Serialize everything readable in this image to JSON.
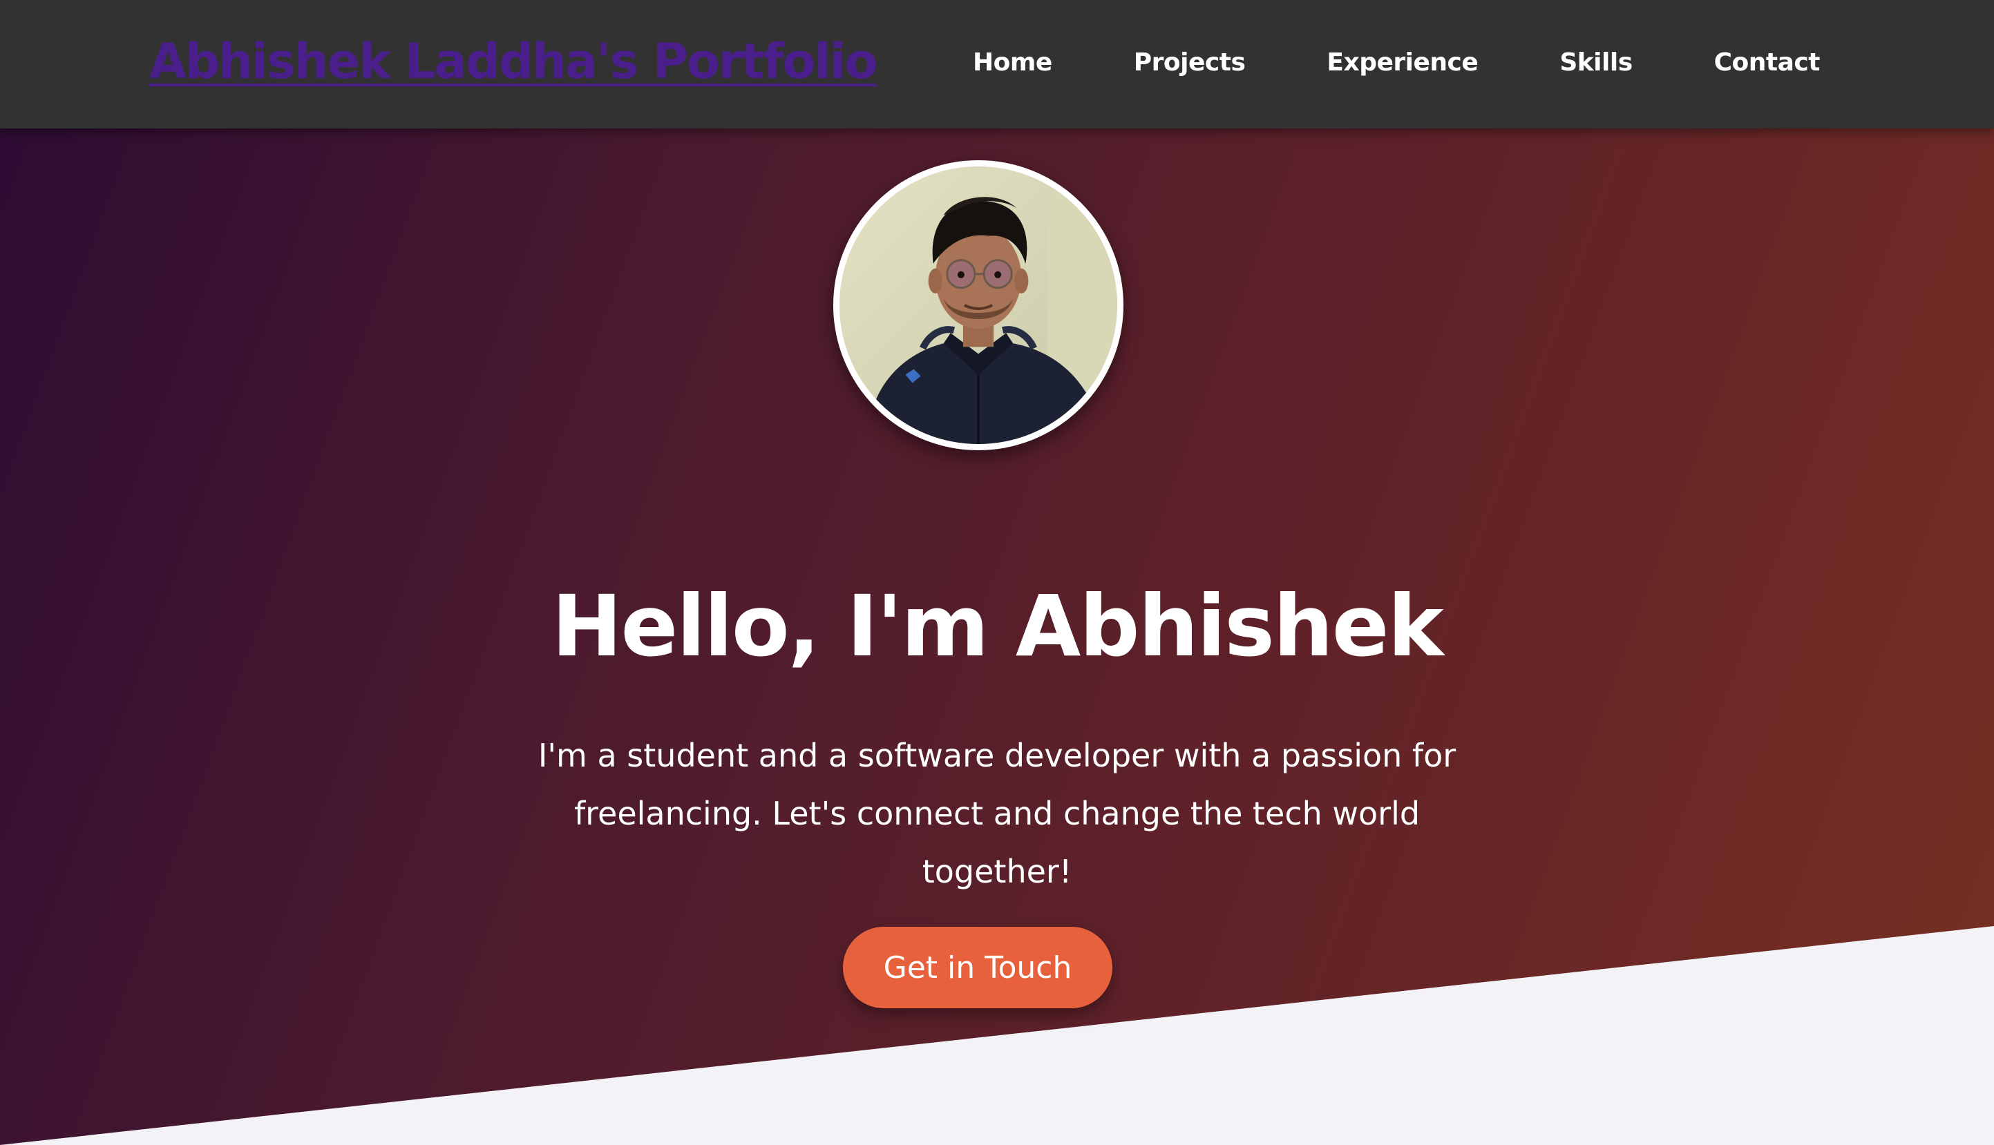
{
  "navbar": {
    "brand": "Abhishek Laddha's Portfolio",
    "links": [
      {
        "label": "Home"
      },
      {
        "label": "Projects"
      },
      {
        "label": "Experience"
      },
      {
        "label": "Skills"
      },
      {
        "label": "Contact"
      }
    ]
  },
  "hero": {
    "title": "Hello, I'm Abhishek",
    "description": "I'm a student and a software developer with a passion for freelancing. Let's connect and change the tech world together!",
    "cta_label": "Get in Touch",
    "avatar_alt": "profile photo"
  },
  "colors": {
    "navbar_bg": "#333232",
    "brand": "#4a1f8c",
    "gradient_start": "#2e0c33",
    "gradient_end": "#772f22",
    "cta_bg": "#e8613d",
    "page_bg": "#f3f3f7"
  }
}
